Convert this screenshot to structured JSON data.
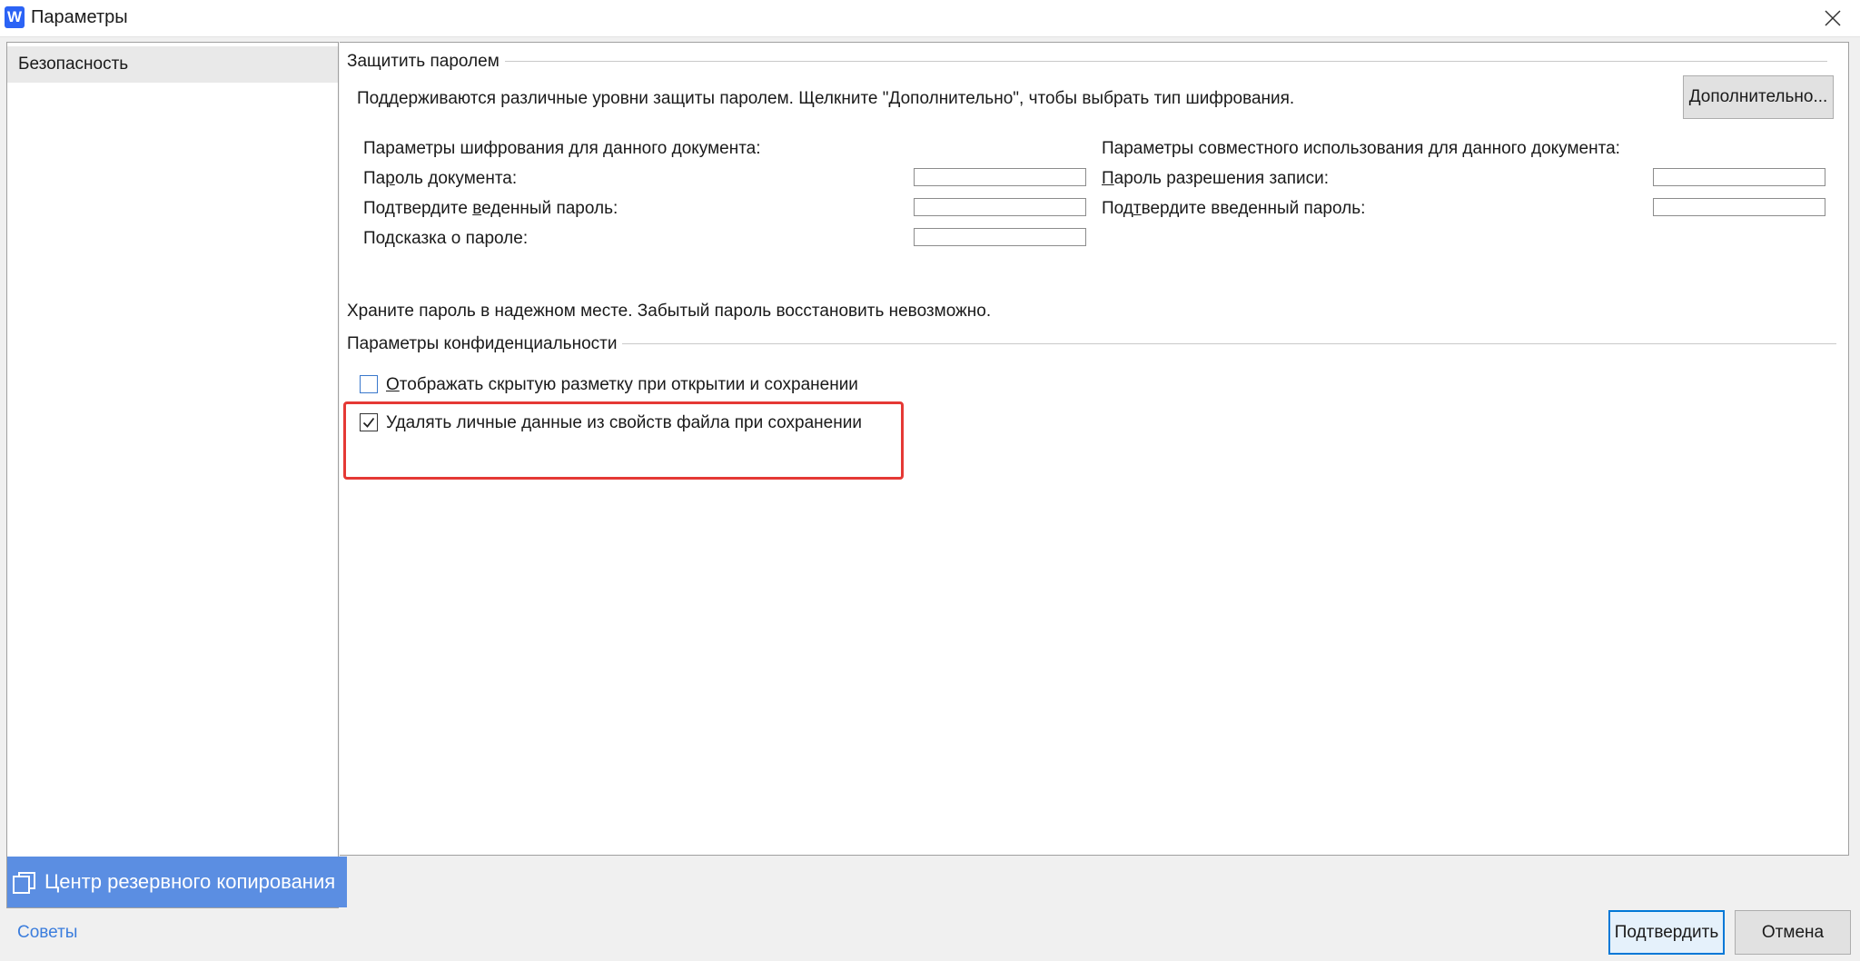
{
  "window": {
    "app_icon_letter": "W",
    "title": "Параметры"
  },
  "sidebar": {
    "items": [
      {
        "label": "Безопасность",
        "selected": true
      }
    ],
    "backup_center": "Центр резервного копирования",
    "tips_link": "Советы"
  },
  "password_section": {
    "title": "Защитить паролем",
    "description": "Поддерживаются различные уровни защиты паролем. Щелкните \"Дополнительно\", чтобы выбрать тип шифрования.",
    "advanced_button": "Дополнительно...",
    "encryption": {
      "heading": "Параметры шифрования для данного документа:",
      "password_label_pre": "Па",
      "password_label_key": "р",
      "password_label_post": "оль документа:",
      "password_value": "",
      "confirm_label_pre": "Подтвердите в",
      "confirm_label_key": "в",
      "confirm_label_post": "еденный пароль:",
      "confirm_value": "",
      "hint_label": "Подсказка о пароле:",
      "hint_value": ""
    },
    "sharing": {
      "heading": "Параметры совместного использования для данного документа:",
      "write_label_key": "П",
      "write_label_post": "ароль разрешения записи:",
      "write_value": "",
      "confirm_label_pre": "Под",
      "confirm_label_key": "т",
      "confirm_label_post": "вердите введенный пароль:",
      "confirm_value": ""
    },
    "warning": "Храните пароль в надежном месте. Забытый пароль восстановить невозможно."
  },
  "privacy_section": {
    "title": "Параметры конфиденциальности",
    "options": [
      {
        "key": "О",
        "label_rest": "тображать скрытую разметку при открытии и сохранении",
        "checked": false
      },
      {
        "key": "",
        "label_rest": "Удалять личные данные из свойств файла при сохранении",
        "checked": true
      }
    ]
  },
  "footer": {
    "confirm_button": "Подтвердить",
    "cancel_button": "Отмена"
  },
  "colors": {
    "accent": "#0078d7",
    "backup_bg": "#5b8ee2",
    "highlight": "#e53935",
    "link": "#3b7ddd"
  }
}
